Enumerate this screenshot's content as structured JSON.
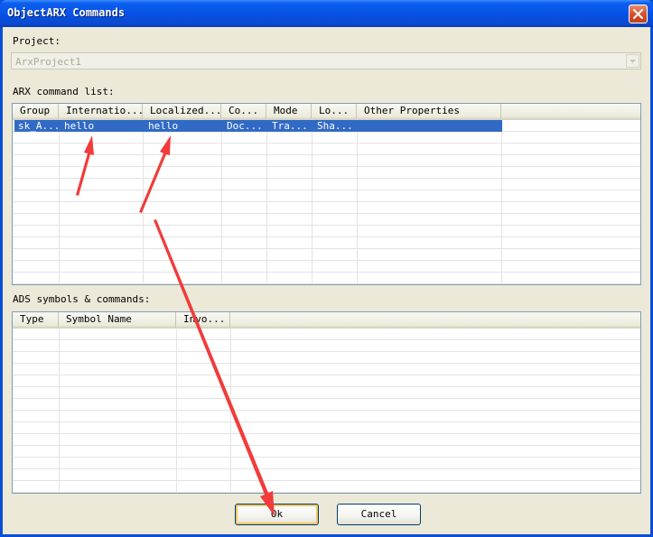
{
  "window": {
    "title": "ObjectARX Commands",
    "close_icon": "close-icon"
  },
  "project": {
    "label": "Project:",
    "value": "ArxProject1"
  },
  "arx_list": {
    "label": "ARX command list:",
    "columns": [
      "Group",
      "Internatio...",
      "Localized...",
      "Co...",
      "Mode",
      "Lo...",
      "Other Properties"
    ],
    "rows": [
      [
        "sk_A...",
        "hello",
        "hello",
        "Doc...",
        "Tra...",
        "Sha...",
        ""
      ]
    ]
  },
  "ads_list": {
    "label": "ADS symbols & commands:",
    "columns": [
      "Type",
      "Symbol Name",
      "Invo..."
    ],
    "rows": []
  },
  "buttons": {
    "ok": "Ok",
    "cancel": "Cancel"
  },
  "colors": {
    "selection": "#316ac5",
    "annotation_arrow": "#f23b3b",
    "titlebar": "#0653e6"
  }
}
